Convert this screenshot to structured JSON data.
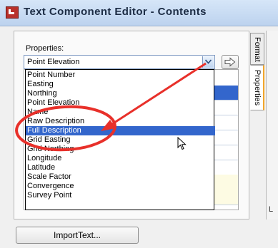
{
  "window": {
    "title": "Text Component Editor - Contents"
  },
  "properties": {
    "label": "Properties:",
    "selected_value": "Point Elevation",
    "options": [
      "Point Number",
      "Easting",
      "Northing",
      "Point Elevation",
      "Name",
      "Raw Description",
      "Full Description",
      "Grid Easting",
      "Grid Northing",
      "Longitude",
      "Latitude",
      "Scale Factor",
      "Convergence",
      "Survey Point"
    ],
    "highlighted_option": "Full Description"
  },
  "tabs": [
    {
      "label": "Format"
    },
    {
      "label": "Properties"
    }
  ],
  "right_panel": {
    "edge_letter": "L"
  },
  "footer": {
    "import_button_label": "ImportText..."
  },
  "colors": {
    "annotation": "#e8302a",
    "selection": "#3366cc",
    "active_tab_accent": "#f2a62a"
  },
  "icons": {
    "app": "text-editor-app-icon",
    "dropdown": "chevron-down-icon",
    "insert": "arrow-right-icon",
    "cursor": "mouse-pointer-icon"
  }
}
